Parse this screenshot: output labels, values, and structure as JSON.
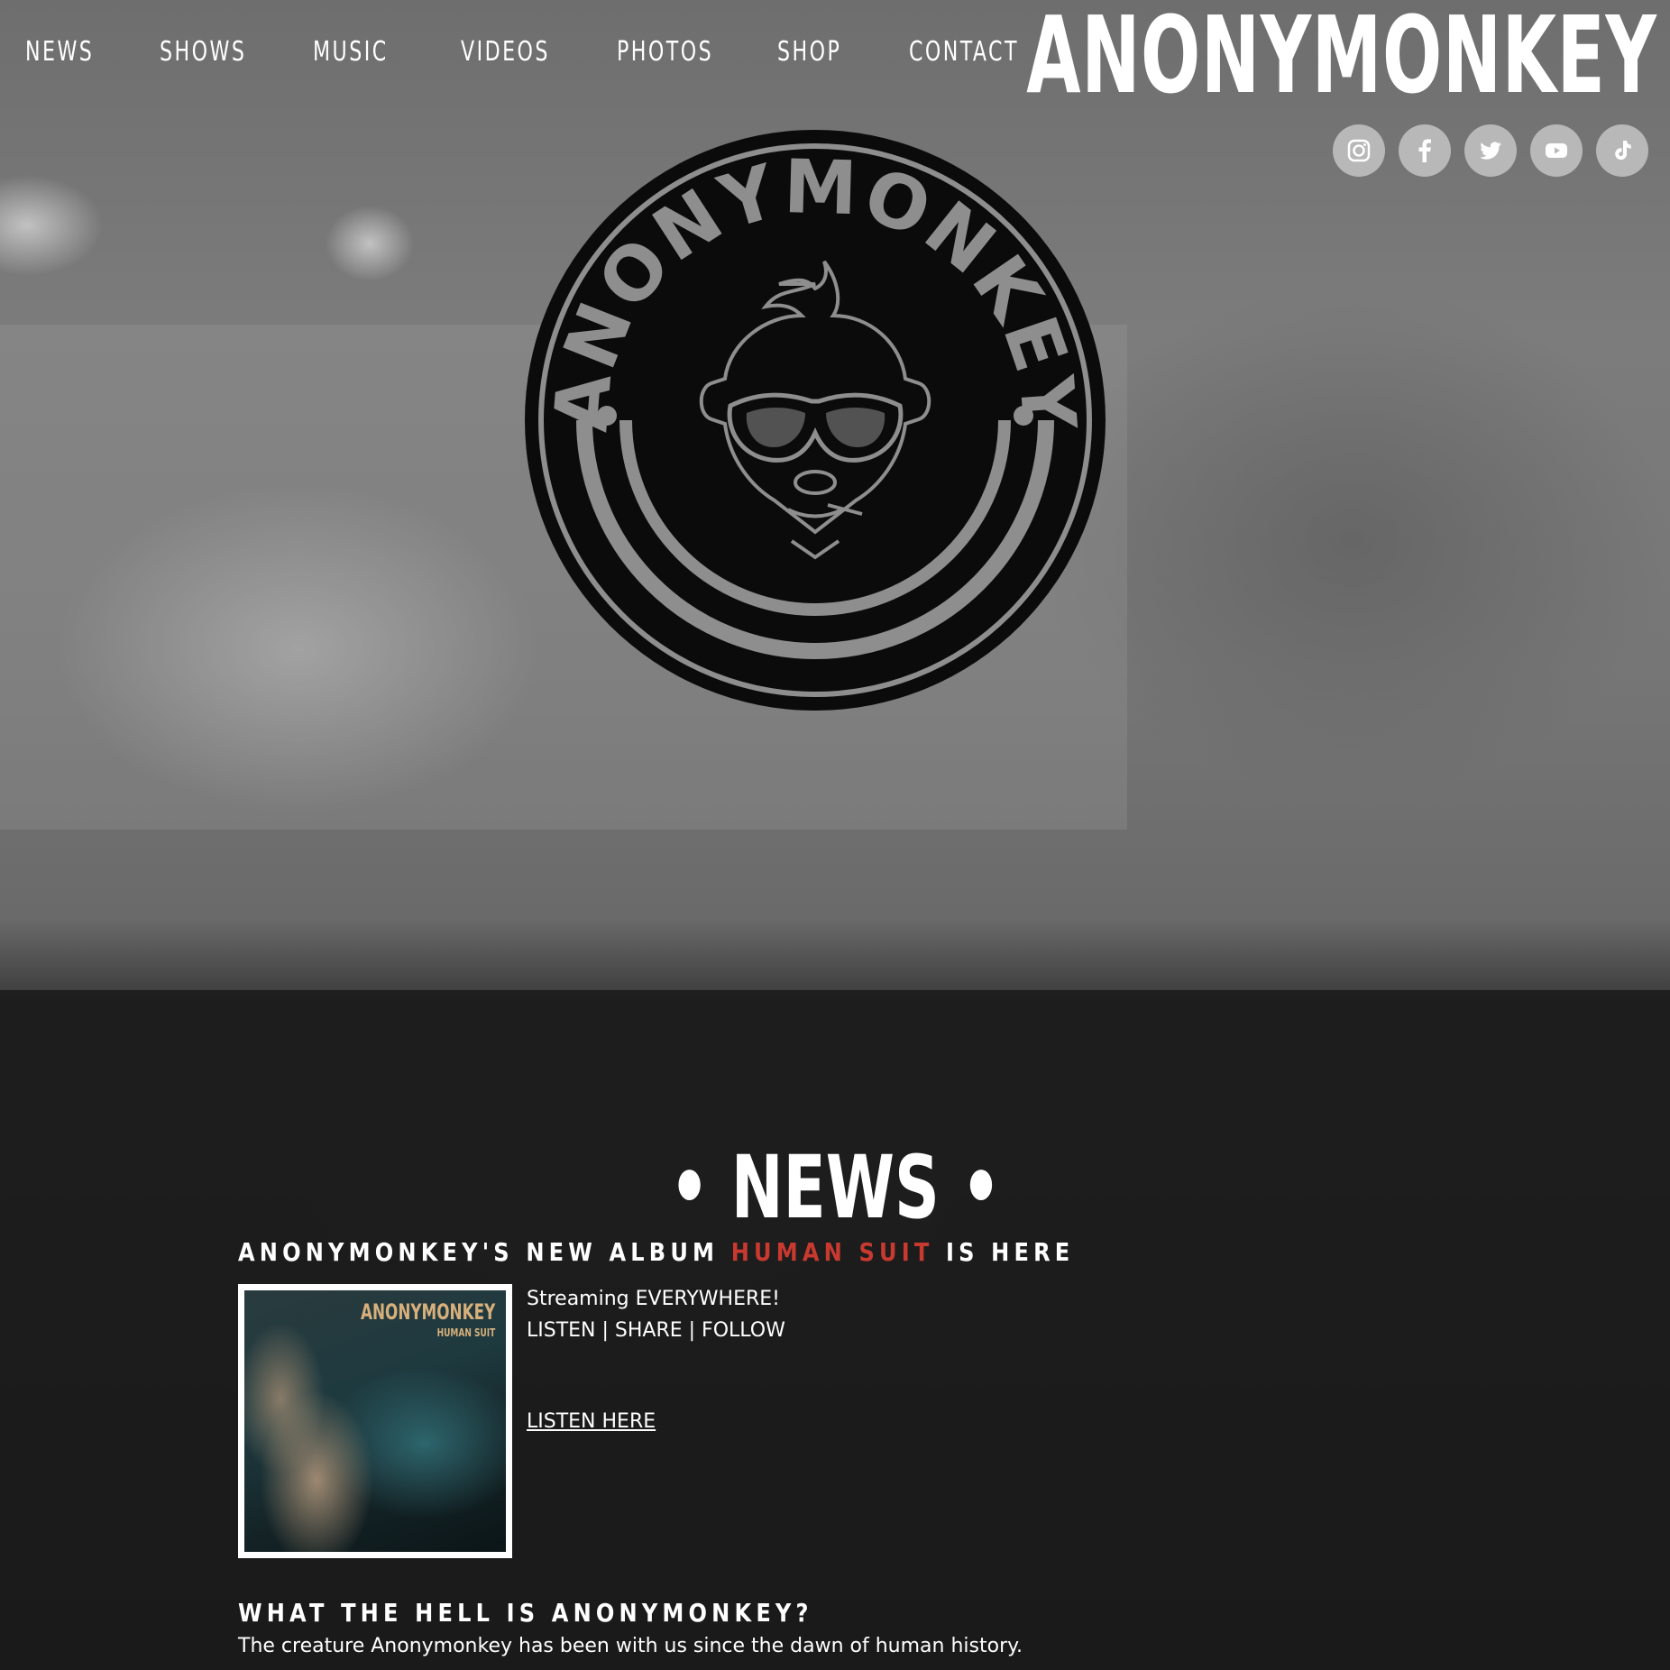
{
  "header": {
    "nav": [
      "NEWS",
      "SHOWS",
      "MUSIC",
      "VIDEOS",
      "PHOTOS",
      "SHOP",
      "CONTACT"
    ],
    "brand": "ANONYMONKEY"
  },
  "social": [
    "instagram-icon",
    "facebook-icon",
    "twitter-icon",
    "youtube-icon",
    "tiktok-icon"
  ],
  "logo": {
    "text": "ANONYMONKEY"
  },
  "news": {
    "title": "• NEWS •",
    "headline_pre": "ANONYMONKEY'S NEW ALBUM ",
    "headline_accent": "HUMAN SUIT",
    "headline_post": " IS HERE",
    "album_cover_brand": "ANONYMONKEY",
    "album_cover_title": "HUMAN SUIT",
    "line1": "Streaming EVERYWHERE!",
    "line2": "LISTEN | SHARE | FOLLOW",
    "link": "LISTEN HERE",
    "about_heading": "WHAT THE HELL IS ANONYMONKEY?",
    "about_text": "The creature Anonymonkey has been with us since the dawn of human history."
  },
  "colors": {
    "accent": "#c8392f",
    "social_bg": "#b8b8b8",
    "band": "#1c1c1c"
  }
}
